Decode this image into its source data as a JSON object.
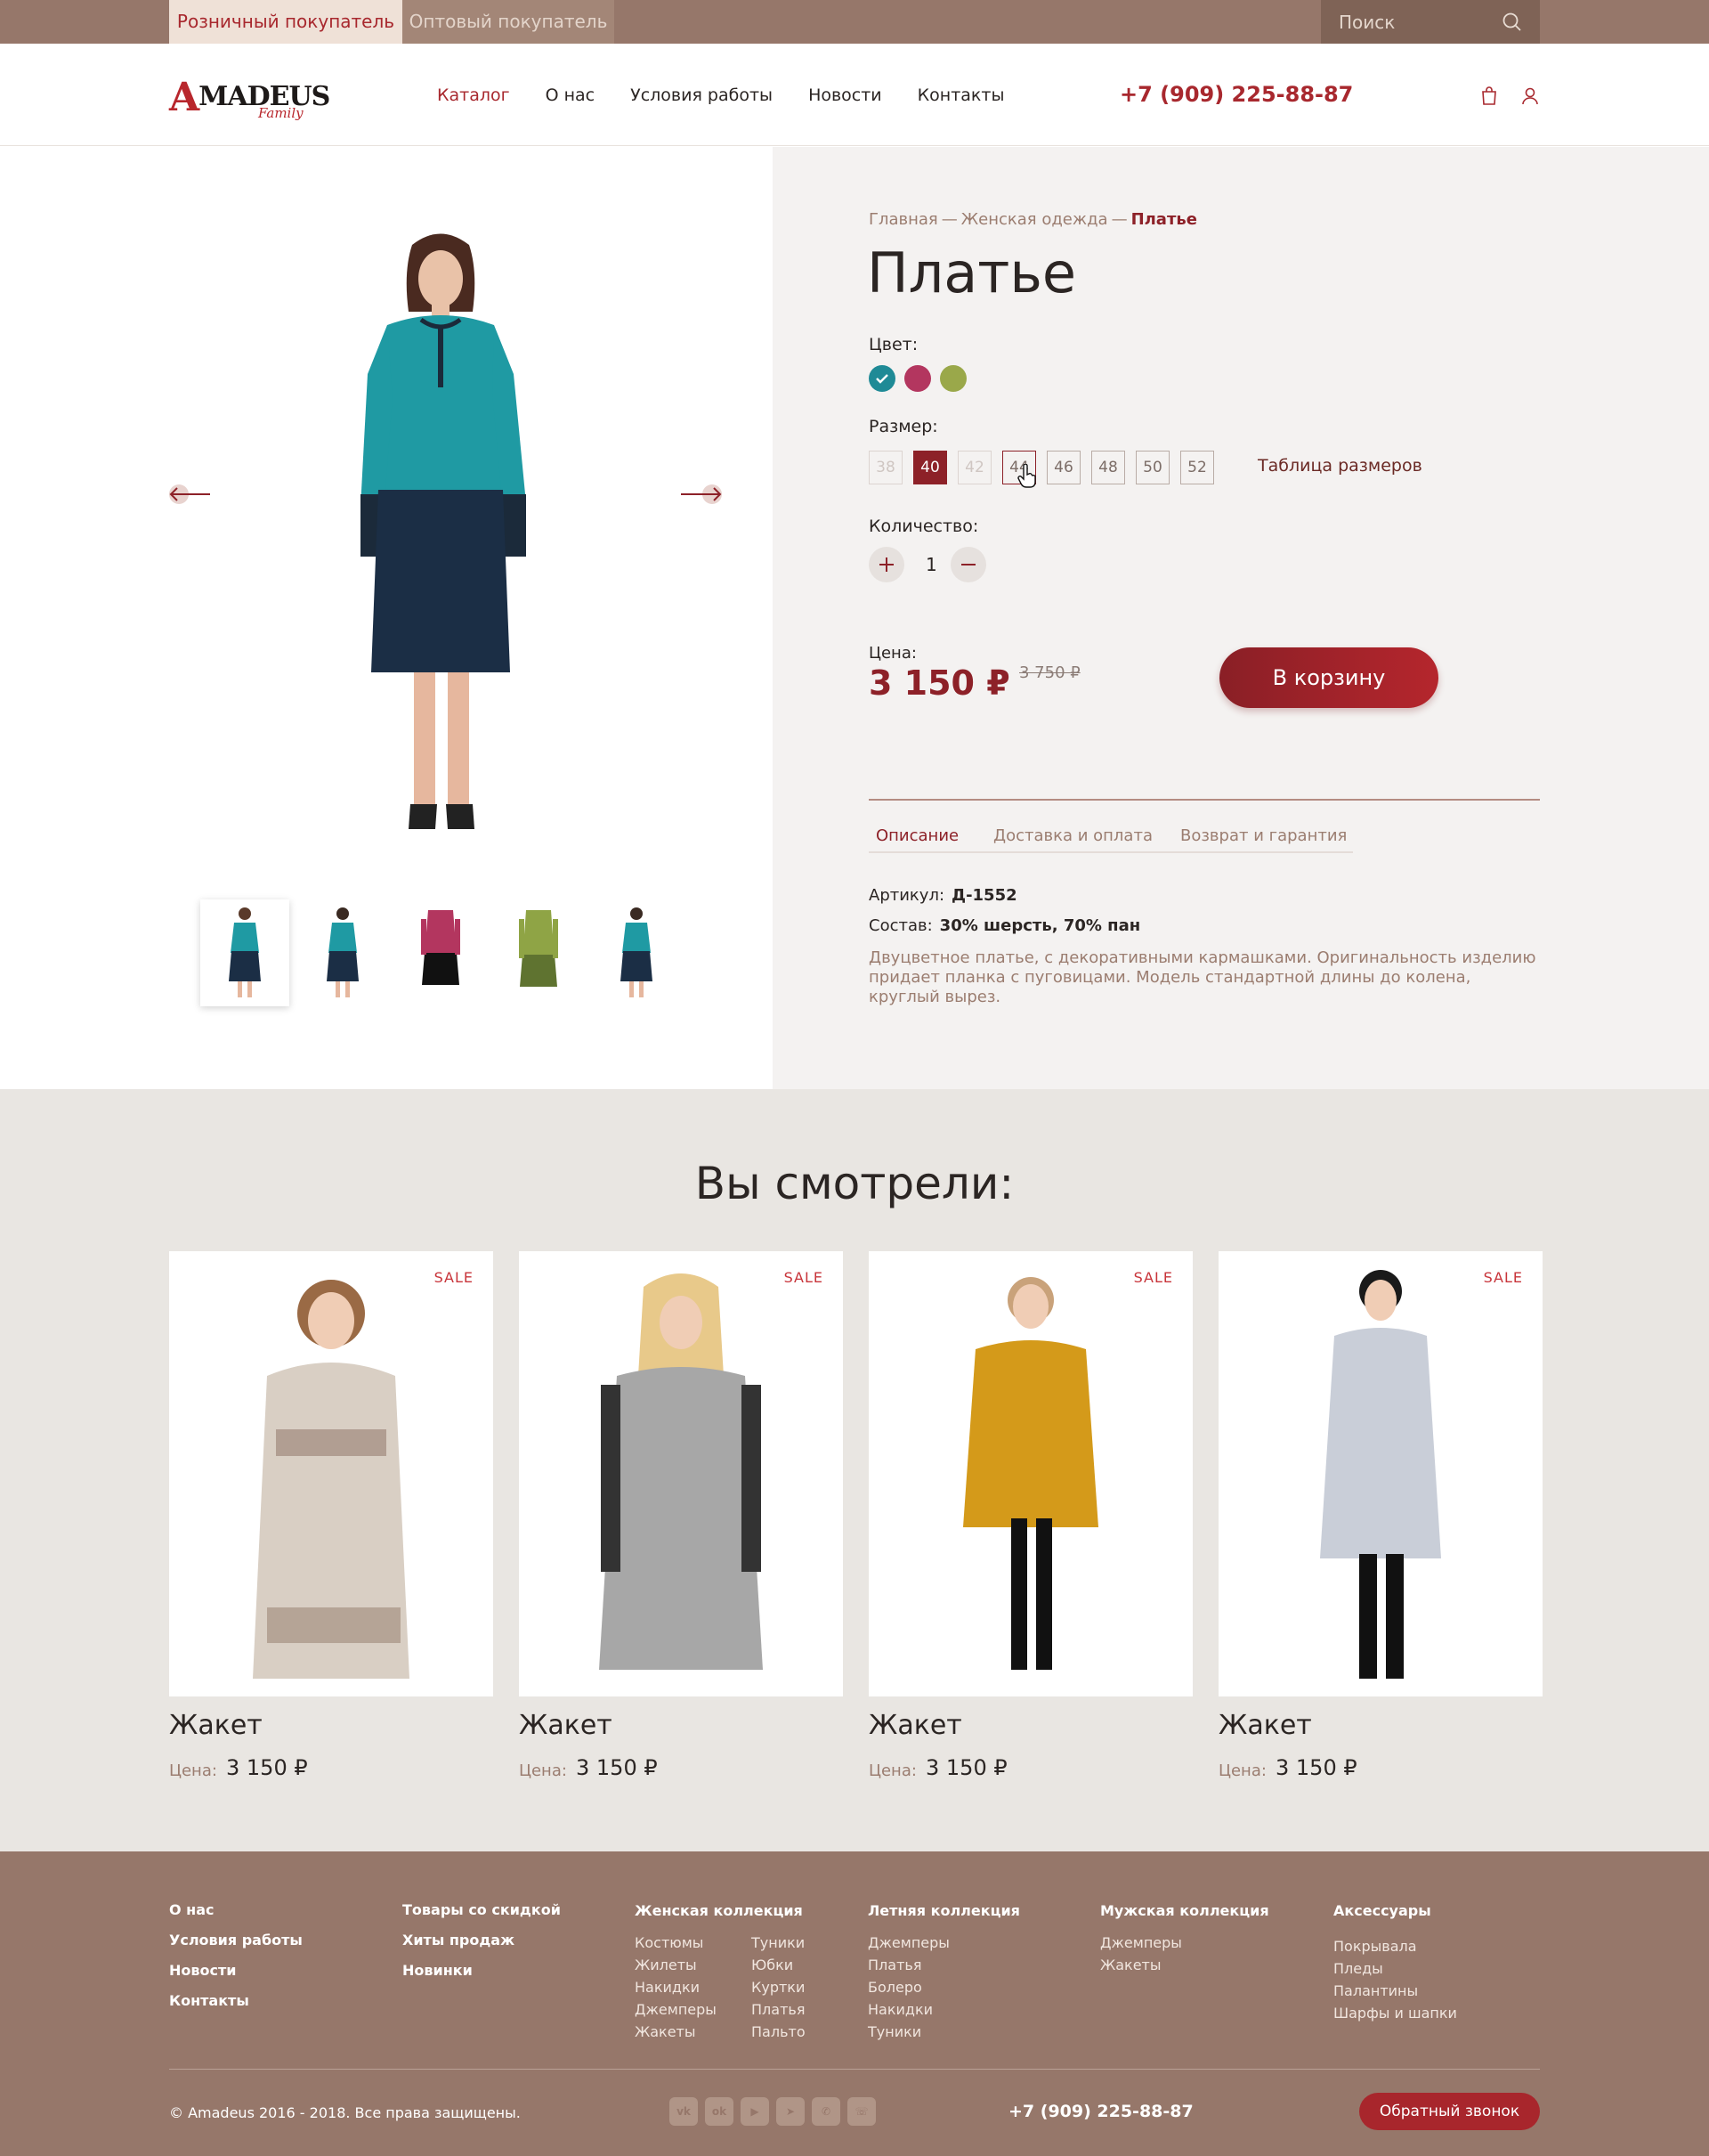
{
  "topbar": {
    "tab_retail": "Розничный покупатель",
    "tab_wholesale": "Оптовый покупатель",
    "search_placeholder": "Поиск"
  },
  "header": {
    "logo_main": "MADEUS",
    "logo_letter": "A",
    "logo_sub": "Family",
    "nav": [
      "Каталог",
      "О нас",
      "Условия работы",
      "Новости",
      "Контакты"
    ],
    "phone": "+7 (909) 225-88-87",
    "icons": [
      "bag-icon",
      "user-icon"
    ]
  },
  "product": {
    "breadcrumb": [
      "Главная",
      "Женская одежда",
      "Платье"
    ],
    "breadcrumb_sep": "—",
    "title": "Платье",
    "color_label": "Цвет:",
    "colors": [
      "#1f8a96",
      "#b3365f",
      "#9aa84a"
    ],
    "selected_color": 0,
    "size_label": "Размер:",
    "sizes": [
      "38",
      "40",
      "42",
      "44",
      "46",
      "48",
      "50",
      "52"
    ],
    "size_selected": "40",
    "size_disabled": [
      "38",
      "42"
    ],
    "size_table_link": "Таблица размеров",
    "qty_label": "Количество:",
    "qty_value": "1",
    "price_label": "Цена:",
    "price": "3 150 ₽",
    "old_price": "3 750 ₽",
    "cart_button": "В корзину",
    "tabs": [
      "Описание",
      "Доставка и оплата",
      "Возврат и гарантия"
    ],
    "article_label": "Артикул:",
    "article_value": "Д-1552",
    "composition_label": "Состав:",
    "composition_value": "30% шерсть, 70% пан",
    "description": "Двуцветное платье, с декоративными кармашками. Оригинальность изделию придает планка с пуговицами. Модель стандартной длины до колена, круглый вырез.",
    "thumb_colors": [
      "#1f9aa3",
      "#1f9aa3",
      "#b3365f",
      "#8fa445",
      "#1f9aa3"
    ]
  },
  "viewed": {
    "title": "Вы смотрели:",
    "items": [
      {
        "sale": "SALE",
        "title": "Жакет",
        "price_label": "Цена:",
        "price": "3 150 ₽"
      },
      {
        "sale": "SALE",
        "title": "Жакет",
        "price_label": "Цена:",
        "price": "3 150 ₽"
      },
      {
        "sale": "SALE",
        "title": "Жакет",
        "price_label": "Цена:",
        "price": "3 150 ₽"
      },
      {
        "sale": "SALE",
        "title": "Жакет",
        "price_label": "Цена:",
        "price": "3 150 ₽"
      }
    ]
  },
  "footer": {
    "col1": [
      "О нас",
      "Условия работы",
      "Новости",
      "Контакты"
    ],
    "col2": [
      "Товары со скидкой",
      "Хиты продаж",
      "Новинки"
    ],
    "women_title": "Женская коллекция",
    "women_a": [
      "Костюмы",
      "Жилеты",
      "Накидки",
      "Джемперы",
      "Жакеты"
    ],
    "women_b": [
      "Туники",
      "Юбки",
      "Куртки",
      "Платья",
      "Пальто"
    ],
    "summer_title": "Летняя коллекция",
    "summer": [
      "Джемперы",
      "Платья",
      "Болеро",
      "Накидки",
      "Туники"
    ],
    "men_title": "Мужская коллекция",
    "men": [
      "Джемперы",
      "Жакеты"
    ],
    "acc_title": "Аксессуары",
    "acc": [
      "Покрывала",
      "Пледы",
      "Палантины",
      "Шарфы и шапки"
    ],
    "copyright": "© Amadeus 2016 - 2018. Все права защищены.",
    "socials": [
      "vk-icon",
      "ok-icon",
      "youtube-icon",
      "telegram-icon",
      "viber-icon",
      "whatsapp-icon"
    ],
    "phone": "+7 (909) 225-88-87",
    "callback": "Обратный звонок"
  }
}
